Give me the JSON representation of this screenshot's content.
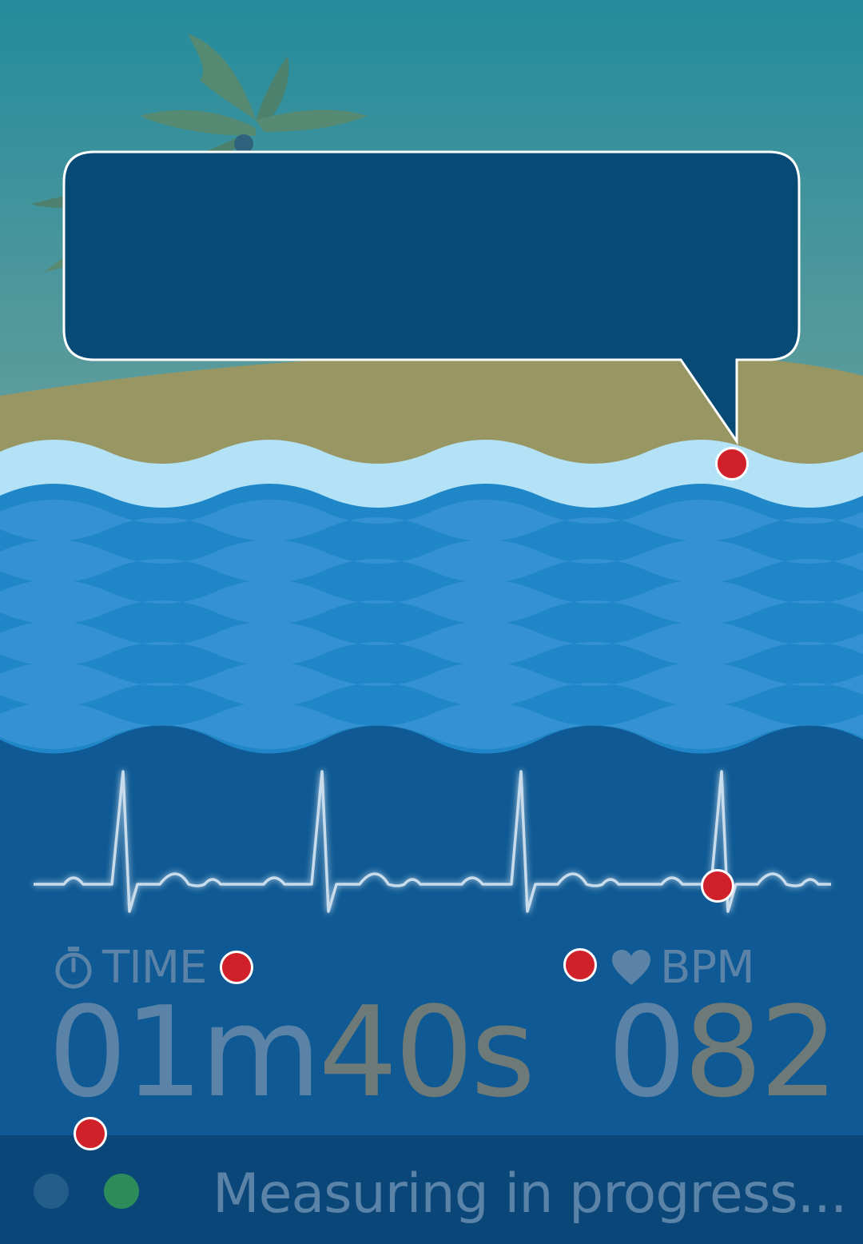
{
  "stats": {
    "time_label": "TIME",
    "time_value": {
      "minutes": "01",
      "m_unit": "m",
      "seconds": "40",
      "s_unit": "s"
    },
    "bpm_label": "BPM",
    "bpm_value": {
      "lead": "0",
      "digits": "82"
    }
  },
  "status": {
    "text": "Measuring in progress..."
  },
  "icons": [
    "stopwatch-icon",
    "heart-icon",
    "palm-tree-icon",
    "speech-bubble"
  ],
  "colors": {
    "sky_top": "#248b9c",
    "sky_bottom": "#5e9a9c",
    "sand": "#989663",
    "foam": "#b3e2f7",
    "water": "#1f87c8",
    "deep_water": "#0f5a94",
    "bubble": "#064a75",
    "marker_red": "#d0202a",
    "indicator_blue": "#245d8a",
    "indicator_green": "#2e8b5a"
  }
}
